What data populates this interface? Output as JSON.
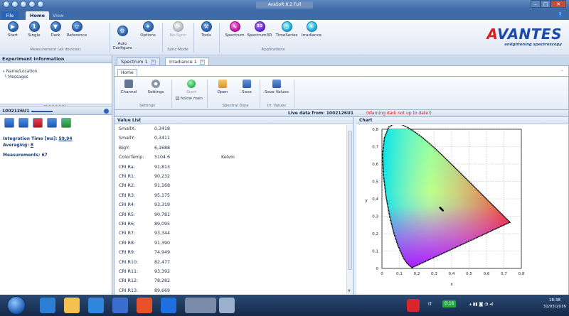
{
  "window": {
    "title": "AvaSoft 8.2 Full"
  },
  "ribbon_tabs": {
    "file": "File",
    "home": "Home",
    "view": "View"
  },
  "ribbon": {
    "buttons": {
      "start": "Start",
      "single": "Single",
      "dark": "Dark",
      "reference": "Reference",
      "auto_configure": "Auto\nConfigure",
      "options": "Options",
      "no_sync": "No Sync",
      "tools": "Tools",
      "spectrum": "Spectrum",
      "spectrum3d": "Spectrum3D",
      "timeseries": "TimeSeries",
      "irradiance": "Irradiance"
    },
    "groups": {
      "measurement": "Measurement (all devices)",
      "sync_mode": "Sync Mode",
      "applications": "Applications"
    },
    "icon_text": {
      "spectrum3d": "3D"
    }
  },
  "logo": {
    "name_prefix": "A",
    "name_rest": "VANTES",
    "tagline": "enlightening spectroscopy"
  },
  "left_panel": {
    "header": "Experiment Information",
    "tree": [
      "Name/Location",
      "Messages"
    ],
    "device_id": "1002126U1",
    "integration_label": "Integration Time [ms]:",
    "integration_value": "59,94",
    "averaging_label": "Averaging:",
    "averaging_value": "8",
    "measurements_label": "Measurements:",
    "measurements_value": "67"
  },
  "doc_tabs": [
    "Spectrum 1",
    "Irradiance 1"
  ],
  "inner": {
    "tab": "Home",
    "buttons": {
      "channel": "Channel",
      "settings": "Settings",
      "start": "Start",
      "open": "Open",
      "save": "Save",
      "save_values": "Save Values"
    },
    "follow_main": "follow main",
    "groups": {
      "settings": "Settings",
      "spectral_data": "Spectral Data",
      "irr_values": "Irr. Values"
    }
  },
  "live_bar": {
    "text": "Live data from: 1002126U1",
    "warning": "(Warning dark not up to date!)"
  },
  "value_list": {
    "header": "Value List",
    "rows": [
      {
        "key": "SmallX:",
        "value": "0,3418",
        "unit": ""
      },
      {
        "key": "SmallY:",
        "value": "0,3411",
        "unit": ""
      },
      {
        "key": "BigY:",
        "value": "6,1688",
        "unit": ""
      },
      {
        "key": "ColorTemp:",
        "value": "5104.6",
        "unit": "Kelvin"
      },
      {
        "key": "CRI Ra:",
        "value": "91,813",
        "unit": ""
      },
      {
        "key": "CRI R1:",
        "value": "90,232",
        "unit": ""
      },
      {
        "key": "CRI R2:",
        "value": "91,168",
        "unit": ""
      },
      {
        "key": "CRI R3:",
        "value": "95,175",
        "unit": ""
      },
      {
        "key": "CRI R4:",
        "value": "93,319",
        "unit": ""
      },
      {
        "key": "CRI R5:",
        "value": "90,781",
        "unit": ""
      },
      {
        "key": "CRI R6:",
        "value": "89,095",
        "unit": ""
      },
      {
        "key": "CRI R7:",
        "value": "93,344",
        "unit": ""
      },
      {
        "key": "CRI R8:",
        "value": "91,390",
        "unit": ""
      },
      {
        "key": "CRI R9:",
        "value": "74,949",
        "unit": ""
      },
      {
        "key": "CRI R10:",
        "value": "82,477",
        "unit": ""
      },
      {
        "key": "CRI R11:",
        "value": "93,392",
        "unit": ""
      },
      {
        "key": "CRI R12:",
        "value": "78,282",
        "unit": ""
      },
      {
        "key": "CRI R13:",
        "value": "89,669",
        "unit": ""
      }
    ]
  },
  "chart": {
    "header": "Chart",
    "x_ticks": [
      "0",
      "0,1",
      "0,2",
      "0,3",
      "0,4",
      "0,5",
      "0,6",
      "0,7",
      "0,8"
    ],
    "y_ticks": [
      "0",
      "0,1",
      "0,2",
      "0,3",
      "0,4",
      "0,5",
      "0,6",
      "0,7",
      "0,8"
    ],
    "xlabel": "x",
    "ylabel": "y",
    "point": {
      "x": 0.3418,
      "y": 0.3411
    }
  },
  "taskbar": {
    "language": "IT",
    "time": "18:38",
    "date": "31/03/2016",
    "date_badge": "0:16"
  },
  "colors": {
    "accent": "#2b5fa8",
    "warning": "#e0141b",
    "logo_blue": "#1c4aa8",
    "logo_red": "#d9201f"
  }
}
